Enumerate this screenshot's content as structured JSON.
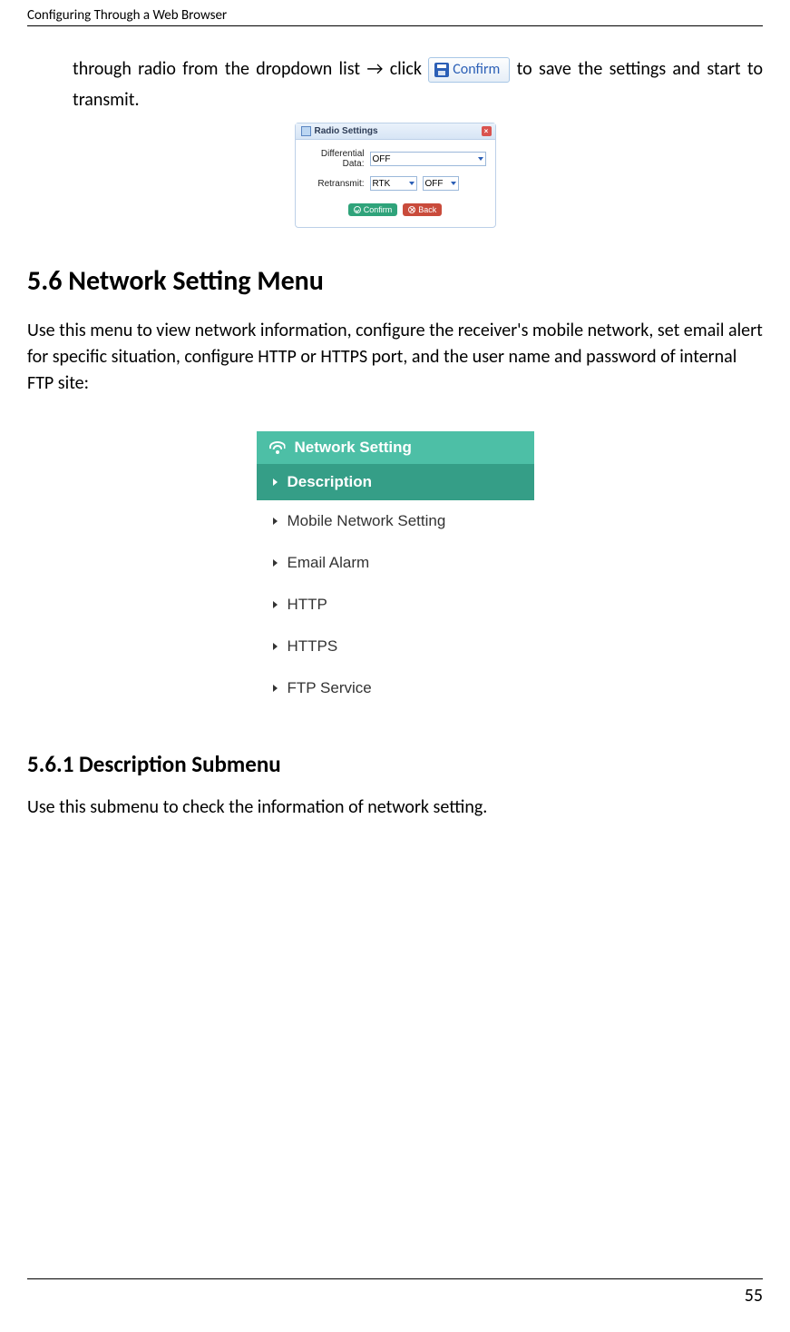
{
  "header": {
    "title": "Configuring Through a Web Browser"
  },
  "intro": {
    "before": "through radio from the dropdown list → click ",
    "confirm_label": "Confirm",
    "after": " to save the settings and start to transmit."
  },
  "radio_dialog": {
    "title": "Radio Settings",
    "rows": {
      "diff_label": "Differential Data:",
      "diff_value": "OFF",
      "retrans_label": "Retransmit:",
      "retrans_v1": "RTK",
      "retrans_v2": "OFF"
    },
    "confirm": "Confirm",
    "back": "Back"
  },
  "section56": {
    "heading": "5.6 Network Setting Menu",
    "para": "Use this menu to view network information, configure the receiver's mobile network, set email alert for specific situation, configure HTTP or HTTPS port, and the user name and password of internal FTP site:"
  },
  "net_menu": {
    "header": "Network Setting",
    "items": {
      "i0": "Description",
      "i1": "Mobile Network Setting",
      "i2": "Email Alarm",
      "i3": "HTTP",
      "i4": "HTTPS",
      "i5": "FTP Service"
    }
  },
  "section561": {
    "heading": "5.6.1 Description Submenu",
    "para": "Use this submenu to check the information of network setting."
  },
  "page_number": "55"
}
